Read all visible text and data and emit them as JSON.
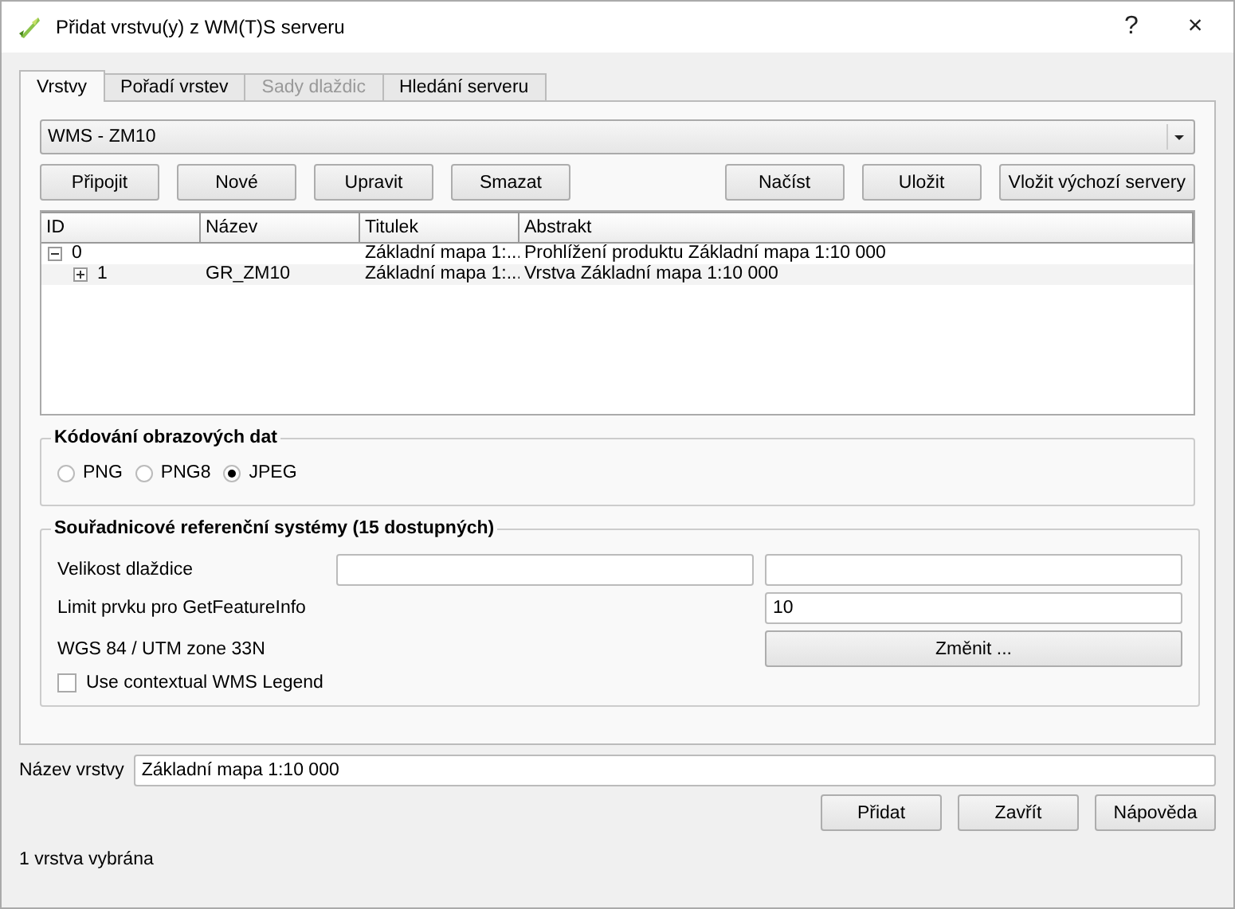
{
  "window": {
    "title": "Přidat vrstvu(y) z WM(T)S serveru",
    "help": "?",
    "close": "×"
  },
  "tabs": [
    {
      "label": "Vrstvy",
      "selected": true,
      "disabled": false
    },
    {
      "label": "Pořadí vrstev",
      "selected": false,
      "disabled": false
    },
    {
      "label": "Sady dlaždic",
      "selected": false,
      "disabled": true
    },
    {
      "label": "Hledání serveru",
      "selected": false,
      "disabled": false
    }
  ],
  "connection": {
    "value": "WMS - ZM10"
  },
  "server_buttons_left": [
    "Připojit",
    "Nové",
    "Upravit",
    "Smazat"
  ],
  "server_buttons_right": [
    "Načíst",
    "Uložit",
    "Vložit výchozí servery"
  ],
  "layer_table": {
    "columns": [
      "ID",
      "Název",
      "Titulek",
      "Abstrakt"
    ],
    "rows": [
      {
        "id": "0",
        "name": "",
        "title": "Základní mapa 1:...",
        "abstract": "Prohlížení produktu Základní mapa 1:10 000",
        "expanded": true,
        "children": [
          {
            "id": "1",
            "name": "GR_ZM10",
            "title": "Základní mapa 1:...",
            "abstract": "Vrstva Základní mapa 1:10 000",
            "expanded": false
          }
        ]
      }
    ]
  },
  "image_encoding": {
    "title": "Kódování obrazových dat",
    "options": [
      {
        "label": "PNG",
        "selected": false
      },
      {
        "label": "PNG8",
        "selected": false
      },
      {
        "label": "JPEG",
        "selected": true
      }
    ]
  },
  "crs": {
    "title": "Souřadnicové referenční systémy  (15 dostupných)",
    "tile_size_label": "Velikost dlaždice",
    "feature_limit_label": "Limit prvku pro GetFeatureInfo",
    "feature_limit": "10",
    "crs_label": "WGS 84 / UTM zone 33N",
    "change_button": "Změnit ...",
    "legend": {
      "label": "Use contextual WMS Legend",
      "checked": false
    }
  },
  "layer_name": {
    "label": "Název vrstvy",
    "value": "Základní mapa 1:10 000"
  },
  "dialog_buttons": [
    "Přidat",
    "Zavřít",
    "Nápověda"
  ],
  "status_bar": "1 vrstva vybrána"
}
